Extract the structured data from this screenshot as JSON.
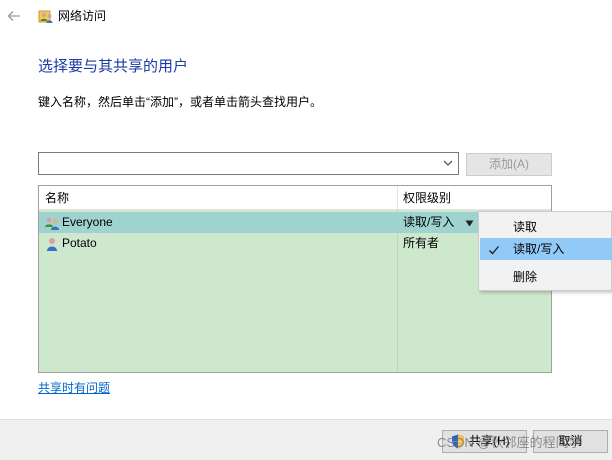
{
  "window": {
    "title": "网络访问",
    "back_icon": "arrow-left-icon"
  },
  "heading": "选择要与其共享的用户",
  "instruction": "键入名称，然后单击“添加”，或者单击箭头查找用户。",
  "user_combo": {
    "value": "",
    "dropdown_icon": "chevron-down-icon"
  },
  "add_button": {
    "label": "添加(A)",
    "enabled": false
  },
  "user_list": {
    "columns": {
      "name": "名称",
      "permission": "权限级别"
    },
    "rows": [
      {
        "name": "Everyone",
        "permission": "读取/写入",
        "icon": "group-users-icon",
        "selected": true
      },
      {
        "name": "Potato",
        "permission": "所有者",
        "icon": "user-icon",
        "selected": false
      }
    ]
  },
  "permission_menu": {
    "items": [
      {
        "label": "读取",
        "checked": false
      },
      {
        "label": "读取/写入",
        "checked": true
      },
      {
        "label": "删除",
        "checked": false
      }
    ]
  },
  "help_link": "共享时有问题",
  "footer": {
    "share_button": "共享(H)",
    "cancel_button": "取消"
  },
  "watermark": "CSDN @秋邻座的程同学",
  "colors": {
    "heading": "#1a3aa5",
    "list_background": "#cde8cd",
    "selected_row": "#9fd3d0",
    "menu_highlight": "#91c9f7",
    "link": "#0066cc"
  }
}
